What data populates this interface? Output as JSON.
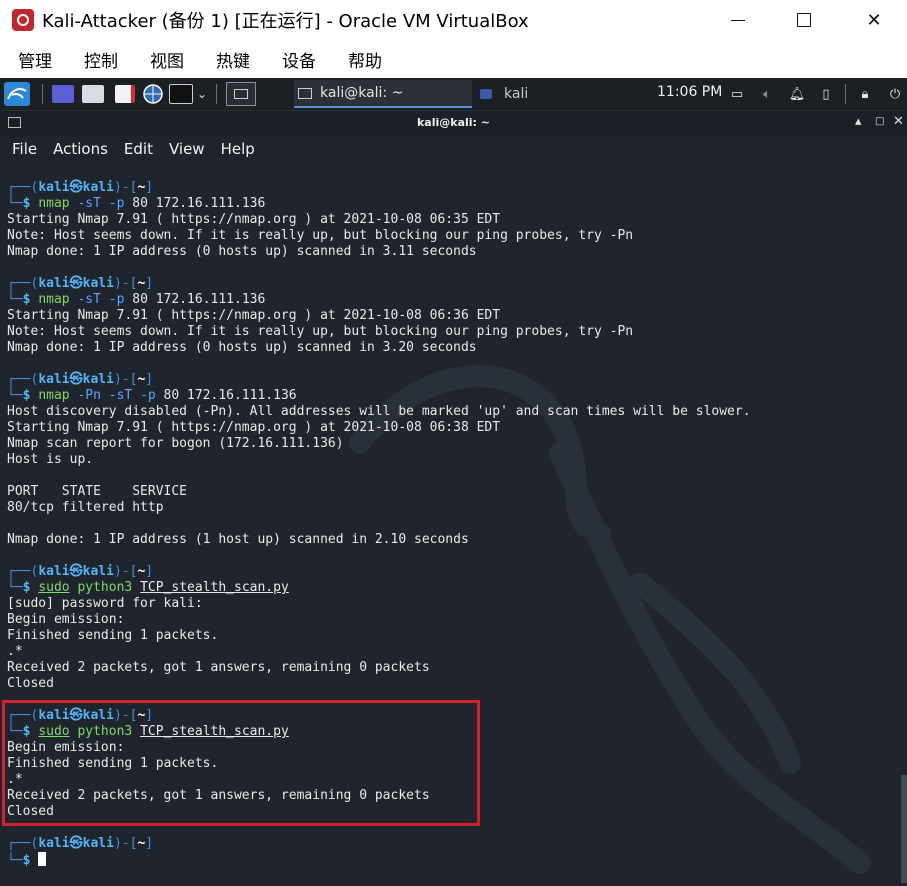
{
  "window": {
    "title": "Kali-Attacker (备份 1) [正在运行] - Oracle VM VirtualBox",
    "controls": {
      "minimize": "—",
      "maximize": "☐",
      "close": "✕"
    }
  },
  "vbox_menu": [
    "管理",
    "控制",
    "视图",
    "热键",
    "设备",
    "帮助"
  ],
  "panel": {
    "active_task": "kali@kali: ~",
    "second_task": "kali",
    "clock": "11:06 PM",
    "icons": [
      "kali-menu-icon",
      "show-desktop-icon",
      "file-manager-icon",
      "text-editor-icon",
      "browser-icon",
      "terminal-icon",
      "dropdown-icon",
      "workspace-icon",
      "display-icon",
      "volume-icon",
      "notifications-icon",
      "battery-icon",
      "lock-icon",
      "power-icon"
    ]
  },
  "terminal": {
    "title": "kali@kali: ~",
    "menu": [
      "File",
      "Actions",
      "Edit",
      "View",
      "Help"
    ],
    "prompt": {
      "open": "┌──(",
      "user": "kali",
      "at": "㉿",
      "host": "kali",
      "close": ")-[",
      "dir": "~",
      "end": "]",
      "second": "└─",
      "sigil": "$"
    },
    "blocks": [
      {
        "command": [
          {
            "t": "nmap",
            "c": "cg"
          },
          {
            "t": " -sT -p",
            "c": "cb"
          },
          {
            "t": " 80 172.16.111.136",
            "c": "cw"
          }
        ],
        "output": [
          "Starting Nmap 7.91 ( https://nmap.org ) at 2021-10-08 06:35 EDT",
          "Note: Host seems down. If it is really up, but blocking our ping probes, try -Pn",
          "Nmap done: 1 IP address (0 hosts up) scanned in 3.11 seconds",
          ""
        ]
      },
      {
        "command": [
          {
            "t": "nmap",
            "c": "cg"
          },
          {
            "t": " -sT -p",
            "c": "cb"
          },
          {
            "t": " 80 172.16.111.136",
            "c": "cw"
          }
        ],
        "output": [
          "Starting Nmap 7.91 ( https://nmap.org ) at 2021-10-08 06:36 EDT",
          "Note: Host seems down. If it is really up, but blocking our ping probes, try -Pn",
          "Nmap done: 1 IP address (0 hosts up) scanned in 3.20 seconds",
          ""
        ]
      },
      {
        "command": [
          {
            "t": "nmap",
            "c": "cg"
          },
          {
            "t": " -Pn -sT -p",
            "c": "cb"
          },
          {
            "t": " 80 172.16.111.136",
            "c": "cw"
          }
        ],
        "output": [
          "Host discovery disabled (-Pn). All addresses will be marked 'up' and scan times will be slower.",
          "Starting Nmap 7.91 ( https://nmap.org ) at 2021-10-08 06:38 EDT",
          "Nmap scan report for bogon (172.16.111.136)",
          "Host is up.",
          "",
          "PORT   STATE    SERVICE",
          "80/tcp filtered http",
          "",
          "Nmap done: 1 IP address (1 host up) scanned in 2.10 seconds",
          ""
        ]
      },
      {
        "command": [
          {
            "t": "sudo",
            "c": "cg ul"
          },
          {
            "t": " python3 ",
            "c": "cg"
          },
          {
            "t": "TCP_stealth_scan.py",
            "c": "cw ul"
          }
        ],
        "output": [
          "[sudo] password for kali:",
          "Begin emission:",
          "Finished sending 1 packets.",
          ".*",
          "Received 2 packets, got 1 answers, remaining 0 packets",
          "Closed",
          ""
        ]
      },
      {
        "command": [
          {
            "t": "sudo",
            "c": "cg ul"
          },
          {
            "t": " python3 ",
            "c": "cg"
          },
          {
            "t": "TCP_stealth_scan.py",
            "c": "cw ul"
          }
        ],
        "output": [
          "Begin emission:",
          "Finished sending 1 packets.",
          ".*",
          "Received 2 packets, got 1 answers, remaining 0 packets",
          "Closed",
          ""
        ]
      },
      {
        "command": [],
        "output": [],
        "cursor": true
      }
    ]
  },
  "colors": {
    "highlight": "#d4202a",
    "prompt_frame": "#3f8ce0",
    "prompt_user": "#4fb6f5",
    "command": "#7fd86a"
  }
}
